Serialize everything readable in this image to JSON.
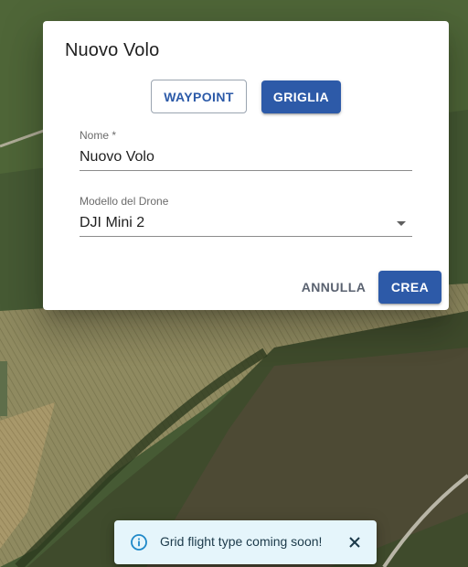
{
  "dialog": {
    "title": "Nuovo Volo",
    "type_buttons": {
      "waypoint_label": "WAYPOINT",
      "grid_label": "GRIGLIA",
      "selected": "GRIGLIA"
    },
    "name_field": {
      "label": "Nome *",
      "value": "Nuovo Volo"
    },
    "drone_field": {
      "label": "Modello del Drone",
      "value": "DJI Mini 2",
      "icon": "chevron-down-icon"
    },
    "actions": {
      "cancel_label": "ANNULLA",
      "create_label": "CREA"
    }
  },
  "snackbar": {
    "message": "Grid flight type coming soon!",
    "icon": "info-icon",
    "close_icon": "close-icon"
  },
  "colors": {
    "primary": "#2d5aa8",
    "snackbar_bg": "#e5f5fb",
    "snackbar_icon": "#1e88c8"
  }
}
